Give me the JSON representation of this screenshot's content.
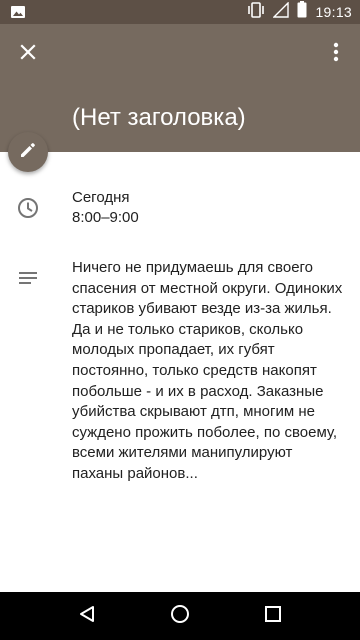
{
  "status_bar": {
    "time": "19:13",
    "icons": [
      "image-notification-icon",
      "vibrate-icon",
      "signal-icon",
      "battery-icon"
    ]
  },
  "toolbar": {
    "close_icon": "close-icon",
    "menu_icon": "more-vert-icon"
  },
  "event": {
    "title": "(Нет заголовка)",
    "date_label": "Сегодня",
    "time_range": "8:00–9:00",
    "description": "Ничего не придумаешь для своего спасения от местной округи. Одиноких стариков убивают везде из-за жилья. Да и не только стариков, сколько молодых пропадает, их губят постоянно, только средств накопят побольше - и их в расход. Заказные убийства скрывают дтп, многим не суждено прожить поболее, по своему, всеми жителями манипулируют паханы районов..."
  },
  "fab": {
    "icon": "edit-icon"
  },
  "nav_bar": {
    "icons": [
      "back-icon",
      "home-icon",
      "recents-icon"
    ]
  },
  "colors": {
    "header": "#766a5f",
    "status_bar": "#5d5046",
    "text_primary": "#212121",
    "icon_grey": "#757575"
  }
}
